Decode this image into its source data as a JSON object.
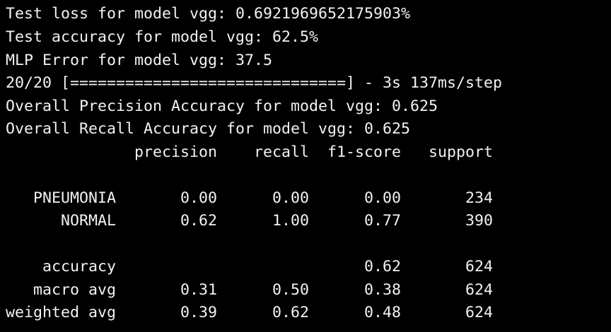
{
  "terminal": {
    "lines": [
      "Test loss for model vgg: 0.6921969652175903%",
      "Test accuracy for model vgg: 62.5%",
      "MLP Error for model vgg: 37.5",
      "20/20 [==============================] - 3s 137ms/step",
      "Overall Precision Accuracy for model vgg: 0.625",
      "Overall Recall Accuracy for model vgg: 0.625",
      "              precision    recall  f1-score   support",
      "",
      "   PNEUMONIA       0.00      0.00      0.00       234",
      "      NORMAL       0.62      1.00      0.77       390",
      "",
      "    accuracy                           0.62       624",
      "   macro avg       0.31      0.50      0.38       624",
      "weighted avg       0.39      0.62      0.48       624"
    ]
  },
  "colors": {
    "background": "#000000",
    "text": "#f2f2f2"
  }
}
